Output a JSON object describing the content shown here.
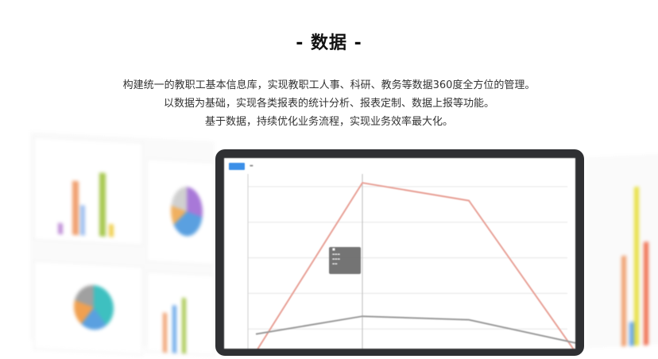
{
  "section": {
    "title": "- 数据 -",
    "description": [
      "构建统一的教职工基本信息库，实现教职工人事、科研、教务等数据360度全方位的管理。",
      "以数据为基础，实现各类报表的统计分析、报表定制、数据上报等功能。",
      "基于数据，持续优化业务流程，实现业务效率最大化。"
    ]
  },
  "colors": {
    "laptop_frame": "#2f3033",
    "screen_bg": "#ffffff",
    "tab_active": "#3b8fe8",
    "line_primary": "#e8a096",
    "line_secondary": "#9a9a9a"
  },
  "chart_data": {
    "type": "line",
    "x": [
      0,
      1,
      2,
      3
    ],
    "series": [
      {
        "values": [
          0,
          95,
          85,
          0
        ]
      },
      {
        "values": [
          10,
          20,
          18,
          5
        ]
      }
    ],
    "ylim": [
      0,
      100
    ]
  }
}
